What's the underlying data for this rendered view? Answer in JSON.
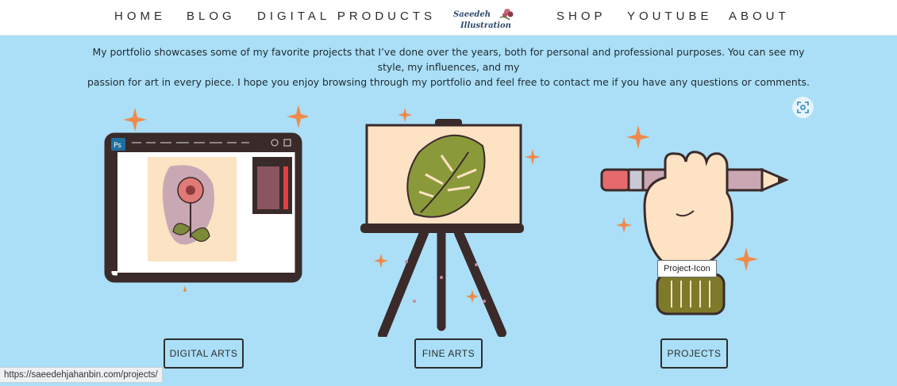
{
  "nav": {
    "home": "HOME",
    "blog": "BLOG",
    "digital_products": "DIGITAL PRODUCTS",
    "shop": "SHOP",
    "youtube": "YOUTUBE",
    "about": "ABOUT",
    "logo_text_line1": "Saeedeh",
    "logo_text_line2": "Illustration"
  },
  "intro": {
    "line1": "My portfolio showcases some of my favorite projects that I’ve done over the years, both for personal and professional purposes. You can see my style, my influences, and my",
    "line2": "passion for art in every piece. I hope you enjoy browsing through my portfolio and feel free to contact me if you have any questions or comments."
  },
  "categories": [
    {
      "label": "DIGITAL ARTS",
      "icon": "photoshop-screen-illustration"
    },
    {
      "label": "FINE ARTS",
      "icon": "easel-leaf-painting-illustration"
    },
    {
      "label": "PROJECTS",
      "icon": "hand-holding-pencil-illustration"
    }
  ],
  "tooltip": "Project-Icon",
  "status_url": "https://saeedehjahanbin.com/projects/",
  "colors": {
    "background": "#aadff7",
    "nav_bg": "#ffffff",
    "outline": "#2d2d2d",
    "accent_orange": "#f08a4b"
  }
}
